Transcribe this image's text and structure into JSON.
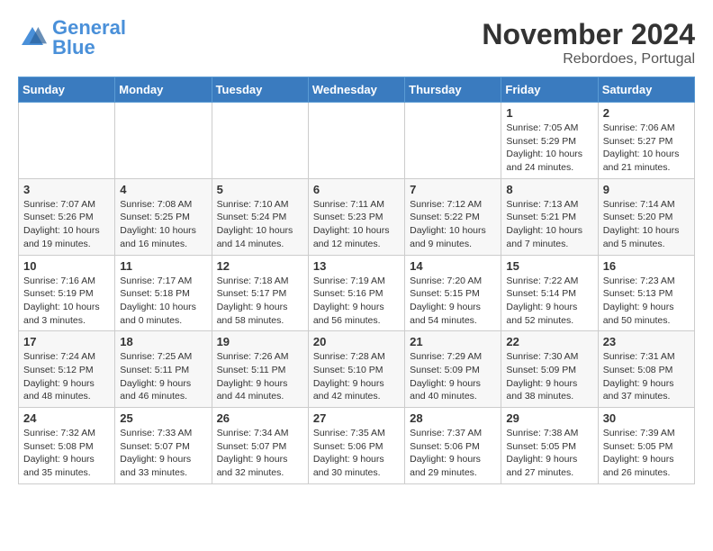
{
  "logo": {
    "general": "General",
    "blue": "Blue"
  },
  "title": "November 2024",
  "subtitle": "Rebordoes, Portugal",
  "weekdays": [
    "Sunday",
    "Monday",
    "Tuesday",
    "Wednesday",
    "Thursday",
    "Friday",
    "Saturday"
  ],
  "weeks": [
    [
      {
        "day": "",
        "info": ""
      },
      {
        "day": "",
        "info": ""
      },
      {
        "day": "",
        "info": ""
      },
      {
        "day": "",
        "info": ""
      },
      {
        "day": "",
        "info": ""
      },
      {
        "day": "1",
        "info": "Sunrise: 7:05 AM\nSunset: 5:29 PM\nDaylight: 10 hours and 24 minutes."
      },
      {
        "day": "2",
        "info": "Sunrise: 7:06 AM\nSunset: 5:27 PM\nDaylight: 10 hours and 21 minutes."
      }
    ],
    [
      {
        "day": "3",
        "info": "Sunrise: 7:07 AM\nSunset: 5:26 PM\nDaylight: 10 hours and 19 minutes."
      },
      {
        "day": "4",
        "info": "Sunrise: 7:08 AM\nSunset: 5:25 PM\nDaylight: 10 hours and 16 minutes."
      },
      {
        "day": "5",
        "info": "Sunrise: 7:10 AM\nSunset: 5:24 PM\nDaylight: 10 hours and 14 minutes."
      },
      {
        "day": "6",
        "info": "Sunrise: 7:11 AM\nSunset: 5:23 PM\nDaylight: 10 hours and 12 minutes."
      },
      {
        "day": "7",
        "info": "Sunrise: 7:12 AM\nSunset: 5:22 PM\nDaylight: 10 hours and 9 minutes."
      },
      {
        "day": "8",
        "info": "Sunrise: 7:13 AM\nSunset: 5:21 PM\nDaylight: 10 hours and 7 minutes."
      },
      {
        "day": "9",
        "info": "Sunrise: 7:14 AM\nSunset: 5:20 PM\nDaylight: 10 hours and 5 minutes."
      }
    ],
    [
      {
        "day": "10",
        "info": "Sunrise: 7:16 AM\nSunset: 5:19 PM\nDaylight: 10 hours and 3 minutes."
      },
      {
        "day": "11",
        "info": "Sunrise: 7:17 AM\nSunset: 5:18 PM\nDaylight: 10 hours and 0 minutes."
      },
      {
        "day": "12",
        "info": "Sunrise: 7:18 AM\nSunset: 5:17 PM\nDaylight: 9 hours and 58 minutes."
      },
      {
        "day": "13",
        "info": "Sunrise: 7:19 AM\nSunset: 5:16 PM\nDaylight: 9 hours and 56 minutes."
      },
      {
        "day": "14",
        "info": "Sunrise: 7:20 AM\nSunset: 5:15 PM\nDaylight: 9 hours and 54 minutes."
      },
      {
        "day": "15",
        "info": "Sunrise: 7:22 AM\nSunset: 5:14 PM\nDaylight: 9 hours and 52 minutes."
      },
      {
        "day": "16",
        "info": "Sunrise: 7:23 AM\nSunset: 5:13 PM\nDaylight: 9 hours and 50 minutes."
      }
    ],
    [
      {
        "day": "17",
        "info": "Sunrise: 7:24 AM\nSunset: 5:12 PM\nDaylight: 9 hours and 48 minutes."
      },
      {
        "day": "18",
        "info": "Sunrise: 7:25 AM\nSunset: 5:11 PM\nDaylight: 9 hours and 46 minutes."
      },
      {
        "day": "19",
        "info": "Sunrise: 7:26 AM\nSunset: 5:11 PM\nDaylight: 9 hours and 44 minutes."
      },
      {
        "day": "20",
        "info": "Sunrise: 7:28 AM\nSunset: 5:10 PM\nDaylight: 9 hours and 42 minutes."
      },
      {
        "day": "21",
        "info": "Sunrise: 7:29 AM\nSunset: 5:09 PM\nDaylight: 9 hours and 40 minutes."
      },
      {
        "day": "22",
        "info": "Sunrise: 7:30 AM\nSunset: 5:09 PM\nDaylight: 9 hours and 38 minutes."
      },
      {
        "day": "23",
        "info": "Sunrise: 7:31 AM\nSunset: 5:08 PM\nDaylight: 9 hours and 37 minutes."
      }
    ],
    [
      {
        "day": "24",
        "info": "Sunrise: 7:32 AM\nSunset: 5:08 PM\nDaylight: 9 hours and 35 minutes."
      },
      {
        "day": "25",
        "info": "Sunrise: 7:33 AM\nSunset: 5:07 PM\nDaylight: 9 hours and 33 minutes."
      },
      {
        "day": "26",
        "info": "Sunrise: 7:34 AM\nSunset: 5:07 PM\nDaylight: 9 hours and 32 minutes."
      },
      {
        "day": "27",
        "info": "Sunrise: 7:35 AM\nSunset: 5:06 PM\nDaylight: 9 hours and 30 minutes."
      },
      {
        "day": "28",
        "info": "Sunrise: 7:37 AM\nSunset: 5:06 PM\nDaylight: 9 hours and 29 minutes."
      },
      {
        "day": "29",
        "info": "Sunrise: 7:38 AM\nSunset: 5:05 PM\nDaylight: 9 hours and 27 minutes."
      },
      {
        "day": "30",
        "info": "Sunrise: 7:39 AM\nSunset: 5:05 PM\nDaylight: 9 hours and 26 minutes."
      }
    ]
  ]
}
